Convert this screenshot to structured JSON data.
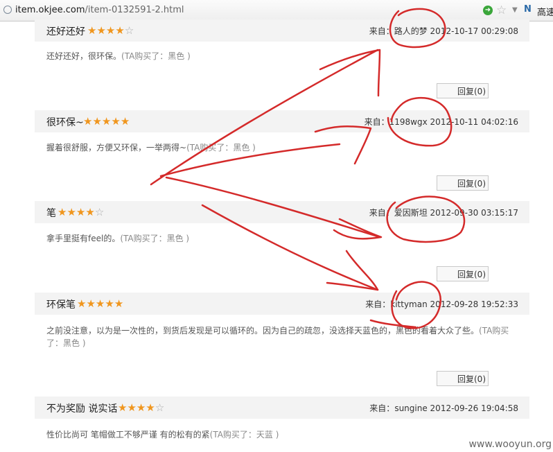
{
  "browser": {
    "url_host": "item.okjee.com",
    "url_path": "/item-0132591-2.html",
    "toolbar_more": "高速"
  },
  "reviews": [
    {
      "title": "还好还好",
      "rating": 4,
      "from_label": "来自：",
      "author": "路人的梦",
      "datetime": "2012-10-17 00:29:08",
      "text": "还好还好，很环保。",
      "bought": "(TA购买了：黑色 )",
      "reply_label": "回复(0)"
    },
    {
      "title": "很环保~",
      "rating": 5,
      "from_label": "来自：",
      "author": "1198wgx",
      "datetime": "2012-10-11 04:02:16",
      "text": "握着很舒服，方便又环保，一举两得~",
      "bought": "(TA购买了：黑色 )",
      "reply_label": "回复(0)"
    },
    {
      "title": "笔",
      "rating": 4,
      "from_label": "来自：",
      "author": "爱因斯坦",
      "datetime": "2012-09-30 03:15:17",
      "text": "拿手里挺有feel的。",
      "bought": "(TA购买了：黑色 )",
      "reply_label": "回复(0)"
    },
    {
      "title": "环保笔",
      "rating": 5,
      "from_label": "来自：",
      "author": "kittyman",
      "datetime": "2012-09-28 19:52:33",
      "text": "之前没注意，以为是一次性的，到货后发现是可以循环的。因为自己的疏忽，没选择天蓝色的，黑色的看着大众了些。",
      "bought": "(TA购买了：黑色 )",
      "reply_label": "回复(0)"
    },
    {
      "title": "不为奖励 说实话",
      "rating": 4,
      "from_label": "来自：",
      "author": "sungine",
      "datetime": "2012-09-26 19:04:58",
      "text": "性价比尚可 笔帽做工不够严谨 有的松有的紧",
      "bought": "(TA购买了：天蓝 )",
      "reply_label": ""
    }
  ],
  "watermark": "www.wooyun.org",
  "annotation_color": "#d42a2a",
  "star_color": "#f0961e"
}
